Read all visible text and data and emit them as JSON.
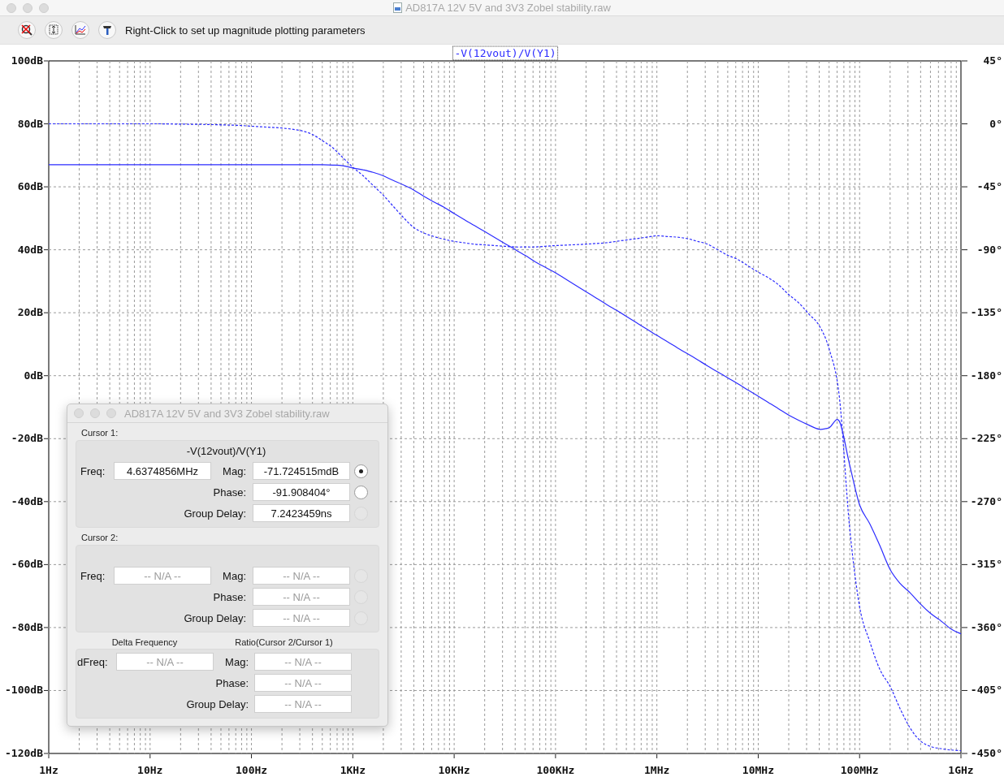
{
  "window": {
    "title": "AD817A 12V 5V and 3V3 Zobel stability.raw"
  },
  "toolbar": {
    "hint": "Right-Click to set up magnitude plotting parameters"
  },
  "plot": {
    "trace_label": "-V(12vout)/V(Y1)",
    "chart_data": {
      "type": "line",
      "grid": true,
      "ylim": [
        -120,
        100
      ],
      "y2lim": [
        -450,
        45
      ],
      "categories": [
        "1Hz",
        null,
        null,
        null,
        null,
        null,
        null,
        null,
        null,
        null,
        "10Hz",
        null,
        null,
        null,
        null,
        null,
        null,
        null,
        null,
        null,
        "100Hz",
        null,
        null,
        null,
        null,
        null,
        null,
        null,
        null,
        null,
        "1KHz",
        null,
        null,
        null,
        null,
        null,
        null,
        null,
        null,
        null,
        "10KHz",
        null,
        null,
        null,
        null,
        null,
        null,
        null,
        null,
        null,
        "100KHz",
        null,
        null,
        null,
        null,
        null,
        null,
        null,
        null,
        null,
        "1MHz",
        null,
        null,
        null,
        null,
        null,
        null,
        null,
        null,
        null,
        "10MHz",
        null,
        null,
        null,
        null,
        null,
        null,
        null,
        null,
        null,
        "100MHz",
        null,
        null,
        null,
        null,
        null,
        null,
        null,
        null,
        null,
        "1GHz"
      ],
      "yticks": [
        {
          "value": 100,
          "label": "100dB"
        },
        {
          "value": 80,
          "label": "80dB"
        },
        {
          "value": 60,
          "label": "60dB"
        },
        {
          "value": 40,
          "label": "40dB"
        },
        {
          "value": 20,
          "label": "20dB"
        },
        {
          "value": 0,
          "label": "0dB"
        },
        {
          "value": -20,
          "label": "-20dB"
        },
        {
          "value": -40,
          "label": "-40dB"
        },
        {
          "value": -60,
          "label": "-60dB"
        },
        {
          "value": -80,
          "label": "-80dB"
        },
        {
          "value": -100,
          "label": "-100dB"
        },
        {
          "value": -120,
          "label": "-120dB"
        }
      ],
      "y2ticks": [
        {
          "value": 45,
          "label": "45°"
        },
        {
          "value": 0,
          "label": "0°"
        },
        {
          "value": -45,
          "label": "-45°"
        },
        {
          "value": -90,
          "label": "-90°"
        },
        {
          "value": -135,
          "label": "-135°"
        },
        {
          "value": -180,
          "label": "-180°"
        },
        {
          "value": -225,
          "label": "-225°"
        },
        {
          "value": -270,
          "label": "-270°"
        },
        {
          "value": -315,
          "label": "-315°"
        },
        {
          "value": -360,
          "label": "-360°"
        },
        {
          "value": -405,
          "label": "-405°"
        },
        {
          "value": -450,
          "label": "-450°"
        }
      ],
      "series": [
        {
          "color": "#2b2bff",
          "line_style": "solid",
          "values": [
            67,
            67,
            67,
            67,
            67,
            67,
            67,
            67,
            67,
            67,
            67,
            67,
            67,
            67,
            67,
            67,
            67,
            67,
            67,
            67,
            67,
            67,
            67,
            67,
            67,
            67,
            67,
            67,
            66.9,
            66.7,
            66,
            65.4,
            64.6,
            63.5,
            62,
            60.6,
            59,
            57,
            55.2,
            53.5,
            51.5,
            49.6,
            47.7,
            45.8,
            43.9,
            42,
            40.1,
            38.2,
            36.2,
            34.4,
            32.7,
            30.7,
            28.7,
            26.7,
            24.7,
            22.7,
            20.8,
            18.8,
            16.8,
            14.8,
            12.8,
            10.9,
            8.9,
            7,
            5.1,
            3.1,
            1.2,
            -0.7,
            -2.6,
            -4.6,
            -6.5,
            -8.5,
            -10.5,
            -12.5,
            -14.2,
            -15.7,
            -17,
            -16.5,
            -14.5,
            -28,
            -41,
            -47,
            -54,
            -61.5,
            -66,
            -69,
            -72.5,
            -75.5,
            -77.8,
            -80.4,
            -82
          ]
        },
        {
          "axis": "y2",
          "color": "#2b2bff",
          "line_style": "dashed",
          "values": [
            0,
            0,
            0,
            0,
            0,
            0,
            0,
            0,
            0,
            0,
            0,
            0,
            -0.1,
            -0.2,
            -0.3,
            -0.4,
            -0.5,
            -0.7,
            -0.9,
            -1.2,
            -1.7,
            -2.1,
            -2.5,
            -3,
            -3.8,
            -5,
            -7.5,
            -12,
            -17,
            -24,
            -31,
            -37,
            -44,
            -51,
            -59,
            -67,
            -74,
            -78,
            -80.5,
            -82.5,
            -84,
            -85,
            -86,
            -86.5,
            -87,
            -87.5,
            -88,
            -88,
            -88,
            -87.5,
            -87,
            -86.7,
            -86.3,
            -86,
            -85.5,
            -85,
            -84,
            -83,
            -82,
            -81,
            -80,
            -80.5,
            -81,
            -82,
            -84,
            -86,
            -90,
            -94,
            -97,
            -101.5,
            -106,
            -110,
            -115,
            -122,
            -128,
            -136,
            -144,
            -161,
            -195,
            -287,
            -345,
            -370,
            -390,
            -402,
            -418,
            -432,
            -441,
            -445,
            -446.5,
            -447.5,
            -448
          ]
        }
      ]
    }
  },
  "cursor_dialog": {
    "title": "AD817A 12V 5V and 3V3 Zobel stability.raw",
    "sections": [
      {
        "kind": "cursor",
        "label": "Cursor 1:",
        "trace": "-V(12vout)/V(Y1)",
        "disabled": false,
        "freq_label": "Freq:",
        "freq": "4.6374856MHz",
        "rows": [
          {
            "label": "Mag:",
            "value": "-71.724515mdB",
            "selected": true,
            "disabled": false
          },
          {
            "label": "Phase:",
            "value": "-91.908404°",
            "selected": false,
            "disabled": false
          },
          {
            "label": "Group Delay:",
            "value": "7.2423459ns",
            "selected": false,
            "disabled": true
          }
        ]
      },
      {
        "kind": "cursor",
        "label": "Cursor 2:",
        "disabled": true,
        "freq_label": "Freq:",
        "freq": "-- N/A --",
        "rows": [
          {
            "label": "Mag:",
            "value": "-- N/A --",
            "selected": false,
            "disabled": true
          },
          {
            "label": "Phase:",
            "value": "-- N/A --",
            "selected": false,
            "disabled": true
          },
          {
            "label": "Group Delay:",
            "value": "-- N/A --",
            "selected": false,
            "disabled": true
          }
        ]
      },
      {
        "kind": "delta",
        "heading_left": "Delta Frequency",
        "heading_right": "Ratio(Cursor 2/Cursor 1)",
        "disabled": true,
        "freq_label": "dFreq:",
        "freq": "-- N/A --",
        "rows": [
          {
            "label": "Mag:",
            "value": "-- N/A --"
          },
          {
            "label": "Phase:",
            "value": "-- N/A --"
          },
          {
            "label": "Group Delay:",
            "value": "-- N/A --"
          }
        ]
      }
    ]
  }
}
